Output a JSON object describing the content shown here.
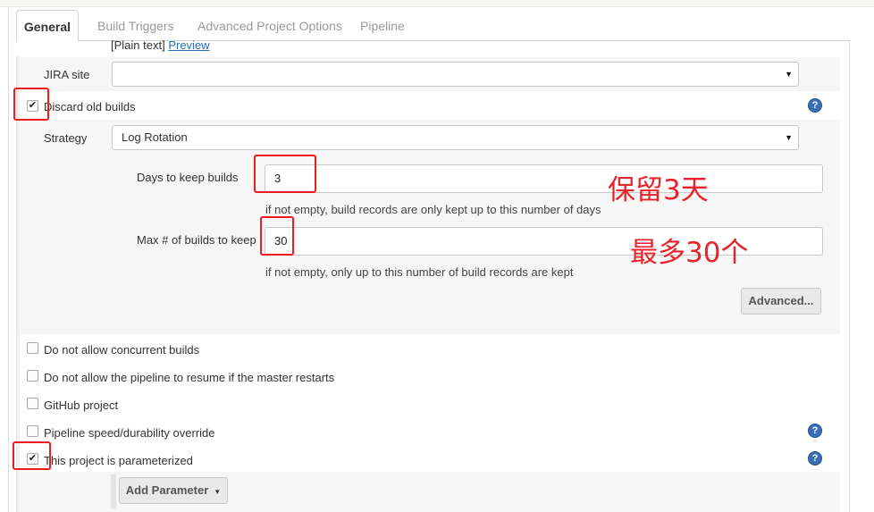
{
  "tabs": [
    {
      "label": "General",
      "active": true
    },
    {
      "label": "Build Triggers",
      "active": false
    },
    {
      "label": "Advanced Project Options",
      "active": false
    },
    {
      "label": "Pipeline",
      "active": false
    }
  ],
  "header": {
    "plain_text": "[Plain text]",
    "preview_link": "Preview"
  },
  "jira": {
    "label": "JIRA site",
    "value": ""
  },
  "discard": {
    "label": "Discard old builds",
    "checked": true,
    "strategy_label": "Strategy",
    "strategy_value": "Log Rotation",
    "days_label": "Days to keep builds",
    "days_value": "3",
    "days_help": "if not empty, build records are only kept up to this number of days",
    "max_label": "Max # of builds to keep",
    "max_value": "30",
    "max_help": "if not empty, only up to this number of build records are kept",
    "advanced_button": "Advanced..."
  },
  "options": [
    {
      "label": "Do not allow concurrent builds",
      "checked": false
    },
    {
      "label": "Do not allow the pipeline to resume if the master restarts",
      "checked": false
    },
    {
      "label": "GitHub project",
      "checked": false
    },
    {
      "label": "Pipeline speed/durability override",
      "checked": false
    },
    {
      "label": "This project is parameterized",
      "checked": true
    }
  ],
  "add_parameter_button": "Add Parameter",
  "annotations": {
    "days_note": "保留3天",
    "max_note": "最多30个"
  },
  "colors": {
    "annotation_red": "#ee1c1c",
    "link_blue": "#2a6ebb",
    "help_blue": "#3a6fb5"
  },
  "icons": {
    "help": "?",
    "check": "✔",
    "dropdown": "▼"
  }
}
